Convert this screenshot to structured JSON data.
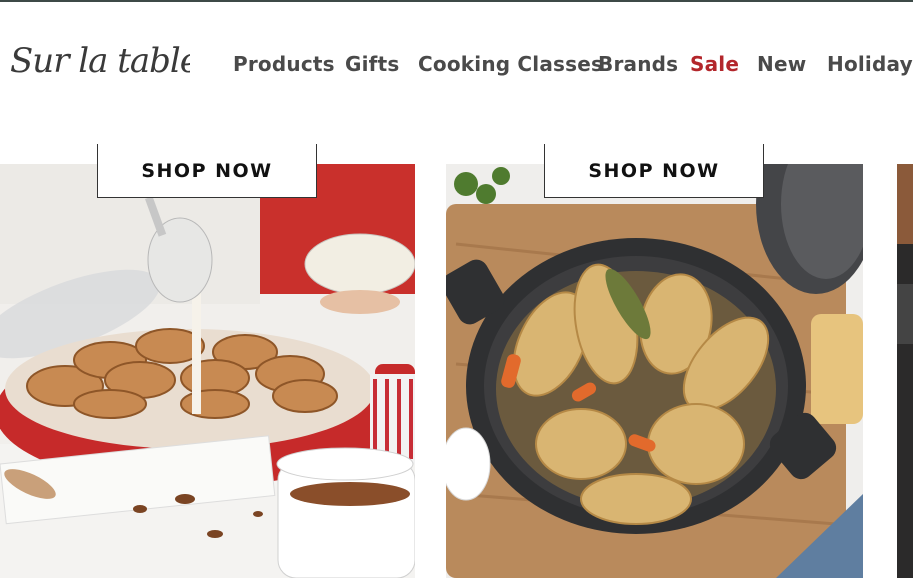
{
  "brand": {
    "logo_text": "Sur la table"
  },
  "nav": {
    "items": [
      {
        "label": "Products"
      },
      {
        "label": "Gifts"
      },
      {
        "label": "Cooking Classes"
      },
      {
        "label": "Brands"
      },
      {
        "label": "Sale"
      },
      {
        "label": "New"
      },
      {
        "label": "Holidays"
      }
    ]
  },
  "promos": [
    {
      "cta_label": "SHOP NOW"
    },
    {
      "cta_label": "SHOP NOW"
    }
  ],
  "colors": {
    "accent_sale": "#b3262b",
    "text": "#4a4a4a",
    "border": "#333333"
  }
}
